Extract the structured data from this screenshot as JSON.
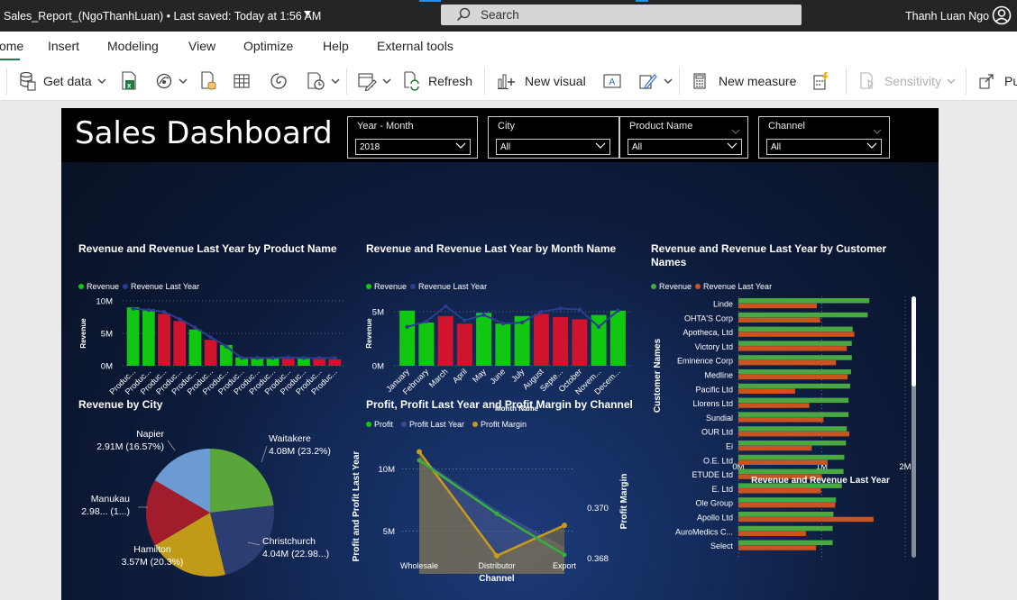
{
  "titlebar": {
    "document": "Sales_Report_(NgoThanhLuan) • Last saved: Today at 1:56 AM",
    "search_placeholder": "Search",
    "user_name": "Thanh Luan Ngo"
  },
  "ribbon_tabs": [
    "ome",
    "Insert",
    "Modeling",
    "View",
    "Optimize",
    "Help",
    "External tools"
  ],
  "toolbar": {
    "get_data": "Get data",
    "refresh": "Refresh",
    "new_visual": "New visual",
    "new_measure": "New measure",
    "sensitivity": "Sensitivity",
    "publish": "Pu"
  },
  "report": {
    "title": "Sales Dashboard",
    "slicers": [
      {
        "label": "Year - Month",
        "value": "2018"
      },
      {
        "label": "City",
        "value": "All"
      },
      {
        "label": "Product Name",
        "value": "All"
      },
      {
        "label": "Channel",
        "value": "All"
      }
    ]
  },
  "colors": {
    "revenue": "#12c712",
    "revenue_below": "#d0142e",
    "revenue_last_year_line": "#2a3d8f",
    "customer_revenue": "#4aa842",
    "customer_revenue_last_year": "#c9541f",
    "profit_margin": "#c99a1a",
    "profit_last_year": "#3a4a8c"
  },
  "chart_data": [
    {
      "type": "bar",
      "title": "Revenue and Revenue Last Year by Product Name",
      "legend": [
        "Revenue",
        "Revenue Last Year"
      ],
      "legend_position": "top-left",
      "ylabel": "Revenue",
      "yticks": [
        "10M",
        "5M",
        "0M"
      ],
      "ylim": [
        0,
        10
      ],
      "y_unit": "M",
      "categories": [
        "Produc...",
        "Produc...",
        "Produc...",
        "Produc...",
        "Produc...",
        "Produc...",
        "Produc...",
        "Produc...",
        "Produc...",
        "Produc...",
        "Produc...",
        "Produc...",
        "Produc...",
        "Produc..."
      ],
      "series": [
        {
          "name": "Revenue",
          "kind": "bar",
          "values": [
            9.0,
            8.7,
            8.0,
            6.9,
            5.6,
            4.0,
            3.2,
            1.3,
            1.2,
            1.2,
            1.1,
            1.1,
            1.1,
            1.0
          ],
          "colors": [
            "green",
            "green",
            "red",
            "red",
            "green",
            "red",
            "green",
            "green",
            "green",
            "green",
            "red",
            "green",
            "red",
            "red"
          ]
        },
        {
          "name": "Revenue Last Year",
          "kind": "line",
          "values": [
            8.8,
            8.6,
            8.3,
            7.2,
            5.9,
            4.4,
            3.0,
            1.2,
            1.2,
            1.2,
            1.3,
            1.2,
            1.2,
            1.2
          ]
        }
      ],
      "grid": true
    },
    {
      "type": "bar",
      "title": "Revenue and Revenue Last Year by Month Name",
      "legend": [
        "Revenue",
        "Revenue Last Year"
      ],
      "legend_position": "top-left",
      "ylabel": "Revenue",
      "xlabel": "Month Name",
      "yticks": [
        "5M",
        "0M"
      ],
      "ylim": [
        0,
        6
      ],
      "y_unit": "M",
      "categories": [
        "January",
        "February",
        "March",
        "April",
        "May",
        "June",
        "July",
        "August",
        "Septe...",
        "October",
        "Novem...",
        "Decem..."
      ],
      "series": [
        {
          "name": "Revenue",
          "kind": "bar",
          "values": [
            5.1,
            4.0,
            4.6,
            3.9,
            4.9,
            3.9,
            4.6,
            4.8,
            4.5,
            4.3,
            4.7,
            5.1
          ],
          "colors": [
            "green",
            "green",
            "red",
            "red",
            "green",
            "green",
            "green",
            "red",
            "red",
            "red",
            "green",
            "green"
          ]
        },
        {
          "name": "Revenue Last Year",
          "kind": "line",
          "values": [
            3.6,
            4.1,
            5.5,
            4.2,
            4.7,
            3.9,
            4.0,
            5.0,
            5.3,
            5.2,
            3.6,
            5.1
          ]
        }
      ],
      "grid": true
    },
    {
      "type": "bar",
      "orientation": "horizontal",
      "title": "Revenue and Revenue Last Year by Customer Names",
      "legend": [
        "Revenue",
        "Revenue Last Year"
      ],
      "legend_position": "top-left",
      "ylabel": "Customer Names",
      "xlabel": "Revenue and Revenue Last Year",
      "xticks": [
        "0M",
        "1M",
        "2M"
      ],
      "xlim": [
        0,
        2
      ],
      "x_unit": "M",
      "categories": [
        "Linde",
        "OHTA'S Corp",
        "Apotheca, Ltd",
        "Victory Ltd",
        "Eminence Corp",
        "Medline",
        "Pacific Ltd",
        "Llorens Ltd",
        "Sundial",
        "OUR Ltd",
        "Ei",
        "O.E. Ltd",
        "ETUDE Ltd",
        "E. Ltd",
        "Ole Group",
        "Apollo Ltd",
        "AuroMedics C...",
        "Select"
      ],
      "series": [
        {
          "name": "Revenue",
          "values": [
            1.57,
            1.55,
            1.37,
            1.36,
            1.36,
            1.35,
            1.34,
            1.32,
            1.32,
            1.3,
            1.29,
            1.27,
            1.26,
            1.24,
            1.17,
            1.14,
            1.13,
            1.13
          ]
        },
        {
          "name": "Revenue Last Year",
          "values": [
            0.94,
            0.98,
            1.39,
            1.3,
            1.17,
            1.31,
            0.68,
            0.85,
            1.02,
            1.33,
            0.88,
            1.07,
            1.0,
            0.99,
            1.16,
            1.62,
            0.81,
            0.93
          ]
        }
      ],
      "grid": true
    },
    {
      "type": "pie",
      "title": "Revenue by City",
      "slices": [
        {
          "label": "Waitakere",
          "value_text": "4.08M (23.2%)",
          "value": 4.08,
          "share": 23.2,
          "color": "#5ba63b"
        },
        {
          "label": "Christchurch",
          "value_text": "4.04M (22.98...)",
          "value": 4.04,
          "share": 22.98,
          "color": "#2c3d73"
        },
        {
          "label": "Hamilton",
          "value_text": "3.57M (20.3%)",
          "value": 3.57,
          "share": 20.3,
          "color": "#c19a18"
        },
        {
          "label": "Manukau",
          "value_text": "2.98... (1...)",
          "value": 2.98,
          "share": 16.95,
          "color": "#a11d2c"
        },
        {
          "label": "Napier",
          "value_text": "2.91M (16.57%)",
          "value": 2.91,
          "share": 16.57,
          "color": "#6b9bd2"
        }
      ]
    },
    {
      "type": "area",
      "title": "Profit, Profit Last Year and Profit Margin by Channel",
      "legend": [
        "Profit",
        "Profit Last Year",
        "Profit Margin"
      ],
      "legend_position": "top-left",
      "ylabel": "Profit and Profit Last Year",
      "y2label": "Profit Margin",
      "xlabel": "Channel",
      "yticks": [
        "10M",
        "5M"
      ],
      "ylim": [
        2,
        12
      ],
      "y_unit": "M",
      "y2ticks": [
        "0.370",
        "0.368"
      ],
      "y2lim": [
        0.3676,
        0.3725
      ],
      "categories": [
        "Wholesale",
        "Distributor",
        "Export"
      ],
      "series": [
        {
          "name": "Profit",
          "values": [
            10.7,
            6.4,
            3.1
          ]
        },
        {
          "name": "Profit Last Year",
          "values": [
            10.8,
            6.6,
            3.6
          ]
        },
        {
          "name": "Profit Margin",
          "axis": "secondary",
          "values": [
            0.3722,
            0.3681,
            0.3693
          ]
        }
      ],
      "grid": true
    }
  ]
}
